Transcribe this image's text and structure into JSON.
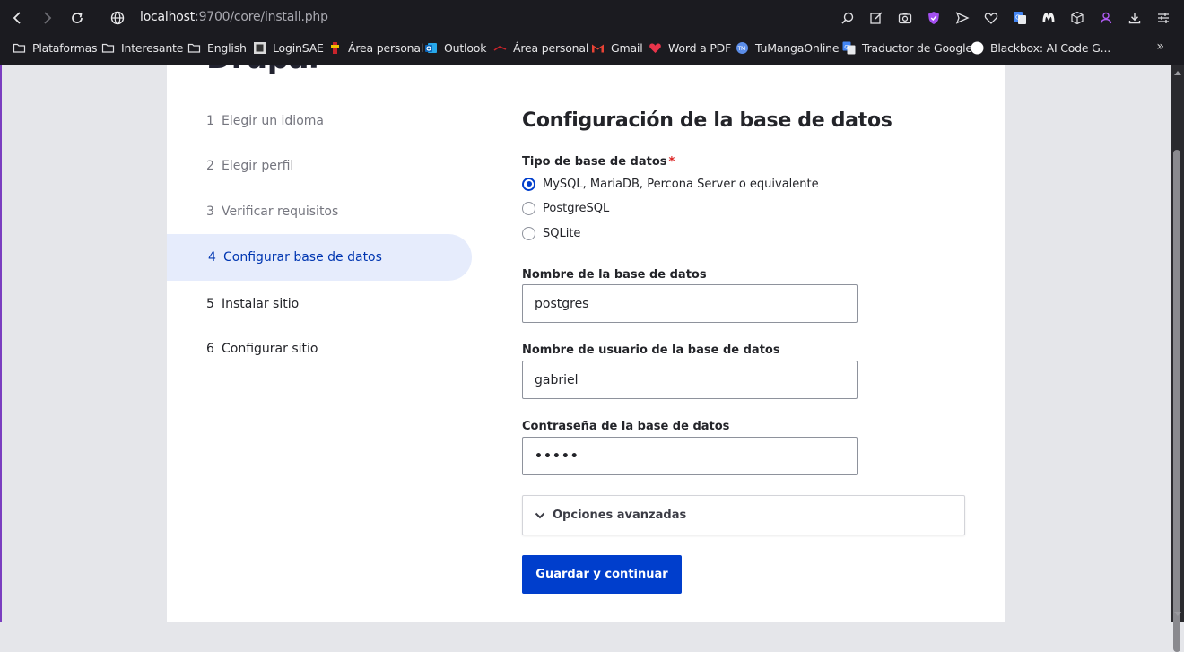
{
  "browser": {
    "url_host": "localhost",
    "url_rest": ":9700/core/install.php",
    "bookmarks": [
      {
        "label": "Plataformas",
        "icon": "folder-icon"
      },
      {
        "label": "Interesante",
        "icon": "folder-icon"
      },
      {
        "label": "English",
        "icon": "folder-icon"
      },
      {
        "label": "LoginSAE",
        "icon": "loginsae-icon"
      },
      {
        "label": "Área personal",
        "icon": "area-personal-icon"
      },
      {
        "label": "Outlook",
        "icon": "outlook-icon"
      },
      {
        "label": "Área personal",
        "icon": "area-personal-red-icon"
      },
      {
        "label": "Gmail",
        "icon": "gmail-icon"
      },
      {
        "label": "Word a PDF",
        "icon": "heart-icon"
      },
      {
        "label": "TuMangaOnline",
        "icon": "tumanga-icon"
      },
      {
        "label": "Traductor de Google",
        "icon": "google-translate-icon"
      },
      {
        "label": "Blackbox: AI Code G...",
        "icon": "blackbox-icon"
      }
    ],
    "bookmarks_more": "»"
  },
  "page": {
    "brand": "Drupal",
    "steps": [
      {
        "num": "1",
        "label": "Elegir un idioma",
        "state": "done"
      },
      {
        "num": "2",
        "label": "Elegir perfil",
        "state": "done"
      },
      {
        "num": "3",
        "label": "Verificar requisitos",
        "state": "done"
      },
      {
        "num": "4",
        "label": "Configurar base de datos",
        "state": "active"
      },
      {
        "num": "5",
        "label": "Instalar sitio",
        "state": "todo"
      },
      {
        "num": "6",
        "label": "Configurar sitio",
        "state": "todo"
      }
    ],
    "heading": "Configuración de la base de datos",
    "db_type_label": "Tipo de base de datos",
    "required_mark": "*",
    "db_options": [
      {
        "label": "MySQL, MariaDB, Percona Server o equivalente",
        "selected": true
      },
      {
        "label": "PostgreSQL",
        "selected": false
      },
      {
        "label": "SQLite",
        "selected": false
      }
    ],
    "db_name_label": "Nombre de la base de datos",
    "db_name_value": "postgres",
    "db_user_label": "Nombre de usuario de la base de datos",
    "db_user_value": "gabriel",
    "db_pass_label": "Contraseña de la base de datos",
    "db_pass_value": "•••••",
    "advanced_label": "Opciones avanzadas",
    "submit_label": "Guardar y continuar"
  },
  "colors": {
    "primary": "#003ecc",
    "active_step_bg": "#e6ecfc",
    "required": "#dc2323",
    "browser_bg": "#1b1b20"
  }
}
